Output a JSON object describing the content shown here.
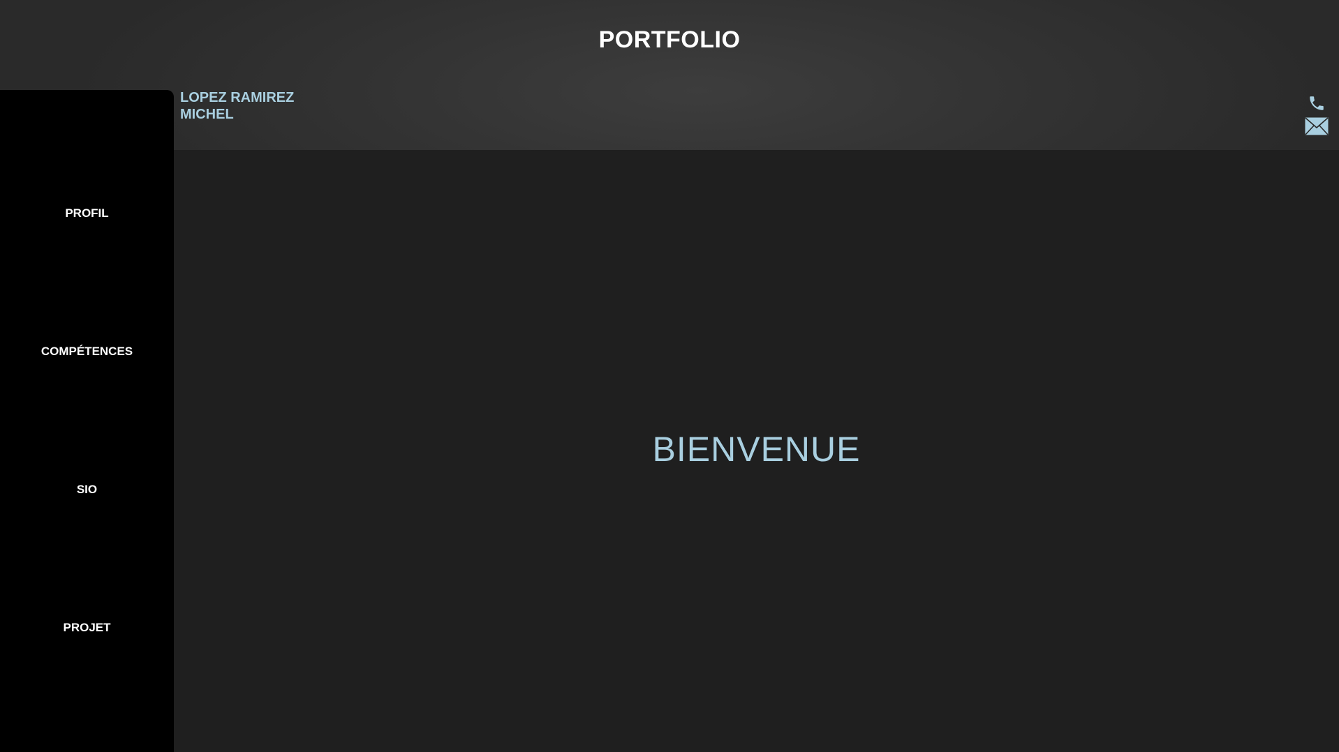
{
  "header": {
    "title": "PORTFOLIO",
    "owner": {
      "last_name": "LOPEZ RAMIREZ",
      "first_name": "MICHEL"
    },
    "contact_icons": [
      "phone-icon",
      "mail-icon"
    ]
  },
  "sidebar": {
    "items": [
      {
        "label": "PROFIL"
      },
      {
        "label": "COMPÉTENCES"
      },
      {
        "label": "SIO"
      },
      {
        "label": "PROJET"
      }
    ]
  },
  "main": {
    "welcome": "BIENVENUE"
  },
  "colors": {
    "accent": "#a9cfe0",
    "sidebar_bg": "#000000",
    "main_bg": "#1f1f1f",
    "header_bg": "#353535"
  }
}
